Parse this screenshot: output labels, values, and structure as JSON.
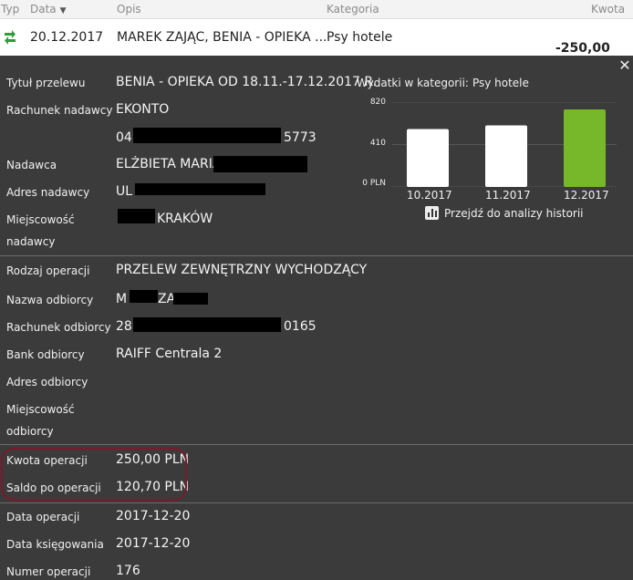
{
  "header": {
    "col_type": "Typ",
    "col_date": "Data",
    "col_desc": "Opis",
    "col_category": "Kategoria",
    "col_amount": "Kwota"
  },
  "transaction": {
    "icon": "transfer-arrows-icon",
    "date": "20.12.2017",
    "description": "MAREK ZAJĄC, BENIA - OPIEKA ...",
    "category": "Psy hotele",
    "amount": "-250,00 PLN"
  },
  "details": {
    "title_label": "Tytuł przelewu",
    "title_value": "BENIA - OPIEKA OD 18.11.-17.12.2017 R.",
    "sender_account_label": "Rachunek nadawcy",
    "sender_bank": "EKONTO",
    "sender_account_prefix": "04",
    "sender_account_suffix": "5773",
    "sender_label": "Nadawca",
    "sender_value": "ELŻBIETA MARIA I",
    "sender_address_label": "Adres nadawcy",
    "sender_address_value": "UL",
    "sender_city_label_1": "Miejscowość",
    "sender_city_label_2": "nadawcy",
    "sender_city_value": "KRAKÓW",
    "operation_type_label": "Rodzaj operacji",
    "operation_type_value": "PRZELEW ZEWNĘTRZNY WYCHODZĄCY",
    "recipient_name_label": "Nazwa odbiorcy",
    "recipient_name_prefix": "M",
    "recipient_name_mid": "ZA",
    "recipient_account_label": "Rachunek odbiorcy",
    "recipient_account_prefix": "28",
    "recipient_account_suffix": "0165",
    "recipient_bank_label": "Bank odbiorcy",
    "recipient_bank_value": "RAIFF Centrala 2",
    "recipient_address_label": "Adres odbiorcy",
    "recipient_city_label_1": "Miejscowość",
    "recipient_city_label_2": "odbiorcy",
    "amount_label": "Kwota operacji",
    "amount_value": "250,00 PLN",
    "balance_label": "Saldo po operacji",
    "balance_value": "120,70 PLN",
    "op_date_label": "Data operacji",
    "op_date_value": "2017-12-20",
    "booking_date_label": "Data księgowania",
    "booking_date_value": "2017-12-20",
    "op_number_label": "Numer operacji",
    "op_number_value": "176"
  },
  "chart_panel": {
    "title": "Wydatki w kategorii:",
    "category": "Psy hotele",
    "history_link": "Przejdź do analizy historii",
    "colors": {
      "bar_default": "#ffffff",
      "bar_current": "#76b82a"
    }
  },
  "chart_data": {
    "type": "bar",
    "categories": [
      "10.2017",
      "11.2017",
      "12.2017"
    ],
    "values": [
      560,
      595,
      750
    ],
    "ylim": [
      0,
      820
    ],
    "yticks": [
      "820",
      "410",
      "0 PLN"
    ],
    "ytick_values": [
      820,
      410,
      0
    ],
    "highlight_index": 2
  }
}
